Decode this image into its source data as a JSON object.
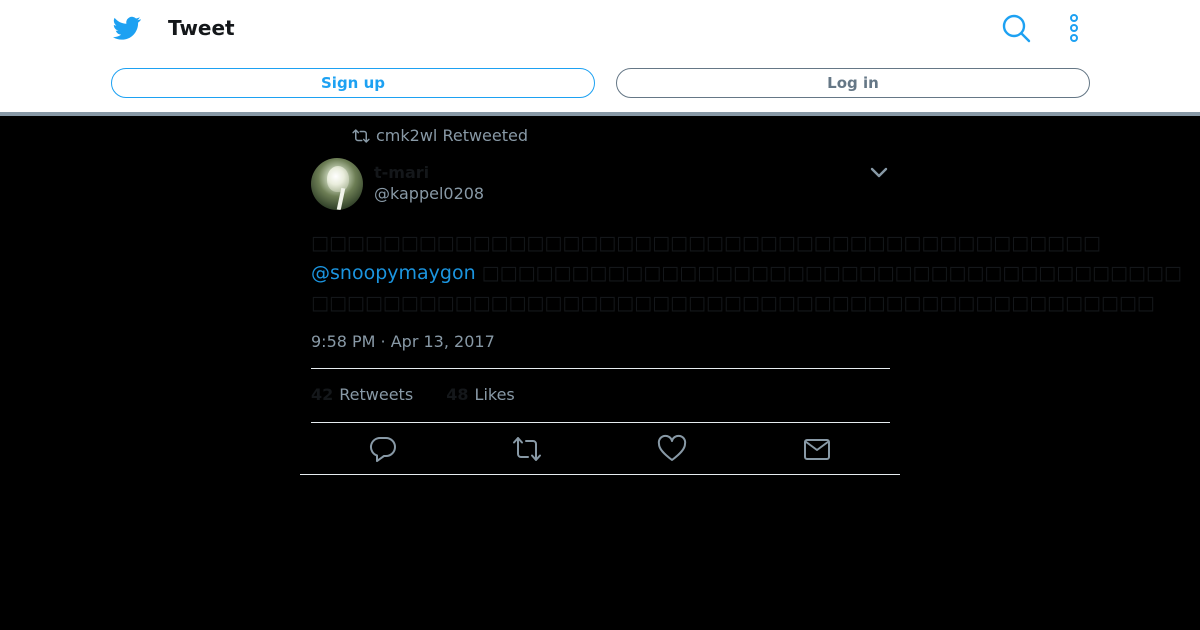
{
  "header": {
    "title": "Tweet",
    "logo_icon": "twitter-bird-icon",
    "search_icon": "search-icon",
    "more_icon": "more-vertical-icon",
    "signup_label": "Sign up",
    "login_label": "Log in",
    "accent": "#1da1f2"
  },
  "tweet": {
    "retweeted_by": "cmk2wl Retweeted",
    "author_name": "t-mari",
    "author_handle": "@kappel0208",
    "text_line1": "□□□□□□□□□□□□□□□□□□□□□□□□□□□□□□□□□□□□□□□□□□□□",
    "mention": "@snoopymaygon",
    "text_line2_rest": " □□□□□□□□□□□□□□□□□□□□□□□□□□□□□□□□□□□□□□□",
    "text_line3": "□□□□□□□□□□□□□□□□□□□□□□□□□□□□□□□□□□□□□□□□□□□□□□□",
    "timestamp": "9:58 PM · Apr 13, 2017",
    "retweets_count": "42",
    "retweets_label": "Retweets",
    "likes_count": "48",
    "likes_label": "Likes",
    "actions": [
      "reply-icon",
      "retweet-icon",
      "like-icon",
      "share-icon"
    ]
  }
}
